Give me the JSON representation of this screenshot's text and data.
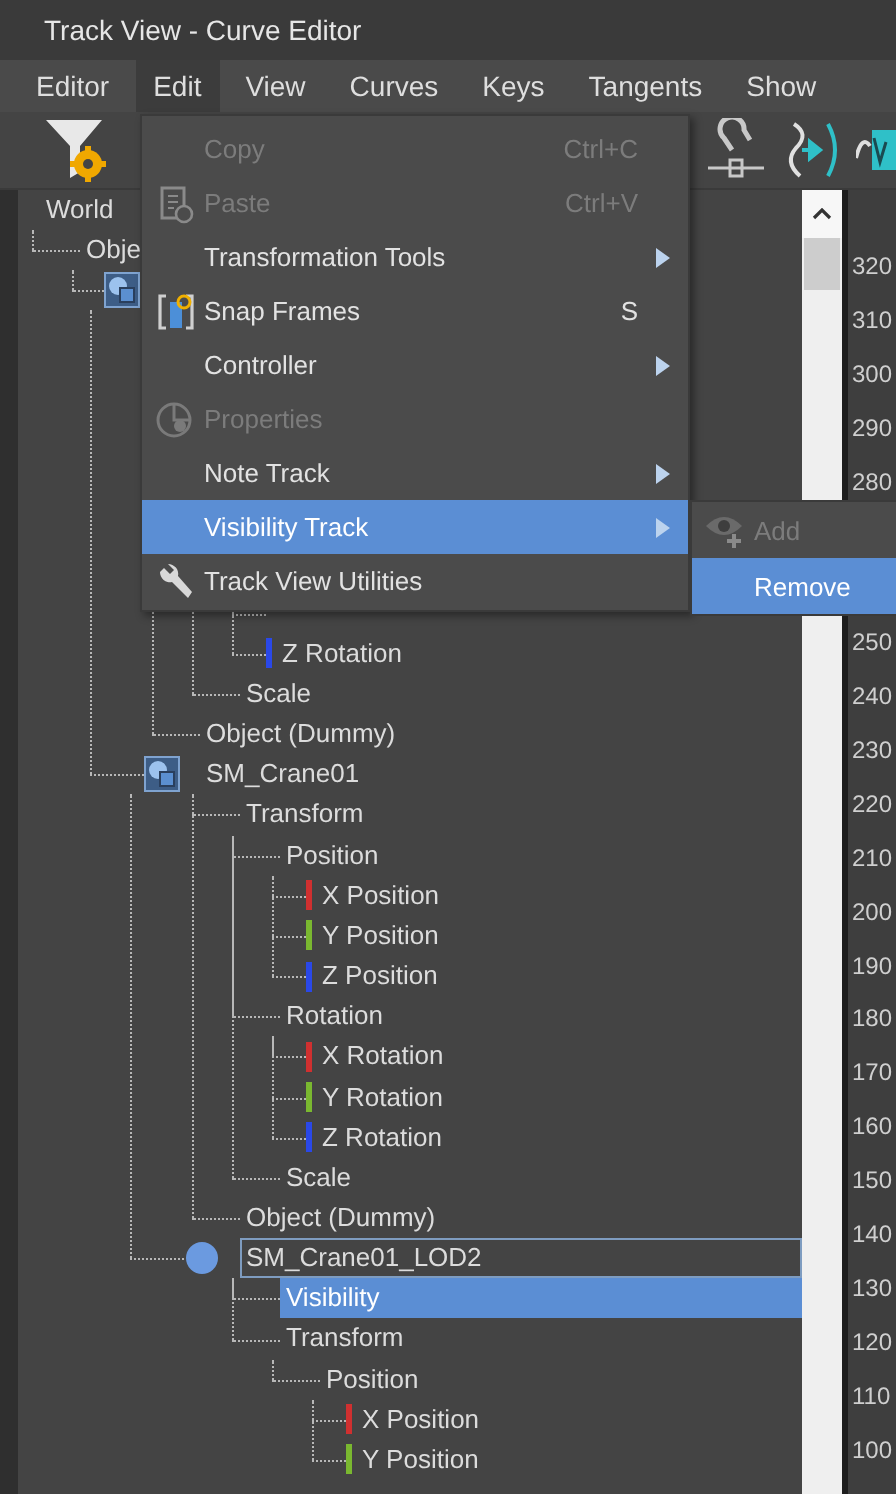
{
  "window": {
    "title": "Track View - Curve Editor"
  },
  "menubar": [
    {
      "label": "Editor",
      "selected": false
    },
    {
      "label": "Edit",
      "selected": true
    },
    {
      "label": "View",
      "selected": false
    },
    {
      "label": "Curves",
      "selected": false
    },
    {
      "label": "Keys",
      "selected": false
    },
    {
      "label": "Tangents",
      "selected": false
    },
    {
      "label": "Show",
      "selected": false
    }
  ],
  "tree": [
    {
      "label": "World",
      "selected": false,
      "focused": false,
      "children": [
        {
          "label": "Obje",
          "selected": false,
          "focused": false,
          "children": [
            {
              "kind": "box",
              "children": [
                {
                  "kind": "track",
                  "children": [
                    {
                      "kind": "track",
                      "children": [
                        {
                          "kind": "axis"
                        },
                        {
                          "kind": "axis"
                        },
                        {
                          "kind": "axis"
                        }
                      ]
                    },
                    {
                      "kind": "track",
                      "children": [
                        {
                          "kind": "axis"
                        },
                        {
                          "kind": "axis"
                        },
                        {
                          "label": "Z Rotation",
                          "kind": "axis",
                          "color": "#2a48e8",
                          "selected": false,
                          "focused": false
                        }
                      ]
                    },
                    {
                      "label": "Scale",
                      "kind": "track",
                      "selected": false,
                      "focused": false
                    }
                  ]
                },
                {
                  "label": "Object (Dummy)",
                  "kind": "track",
                  "selected": false,
                  "focused": false
                },
                {
                  "label": "SM_Crane01",
                  "kind": "box",
                  "selected": false,
                  "focused": false,
                  "children": [
                    {
                      "label": "Transform",
                      "kind": "track",
                      "selected": false,
                      "focused": false,
                      "children": [
                        {
                          "label": "Position",
                          "kind": "track",
                          "selected": false,
                          "focused": false,
                          "children": [
                            {
                              "label": "X Position",
                              "kind": "axis",
                              "color": "#d03030",
                              "selected": false,
                              "focused": false
                            },
                            {
                              "label": "Y Position",
                              "kind": "axis",
                              "color": "#7ab830",
                              "selected": false,
                              "focused": false
                            },
                            {
                              "label": "Z Position",
                              "kind": "axis",
                              "color": "#2a48e8",
                              "selected": false,
                              "focused": false
                            }
                          ]
                        },
                        {
                          "label": "Rotation",
                          "kind": "track",
                          "selected": false,
                          "focused": false,
                          "children": [
                            {
                              "label": "X Rotation",
                              "kind": "axis",
                              "color": "#d03030",
                              "selected": false,
                              "focused": false
                            },
                            {
                              "label": "Y Rotation",
                              "kind": "axis",
                              "color": "#7ab830",
                              "selected": false,
                              "focused": false
                            },
                            {
                              "label": "Z Rotation",
                              "kind": "axis",
                              "color": "#2a48e8",
                              "selected": false,
                              "focused": false
                            }
                          ]
                        },
                        {
                          "label": "Scale",
                          "kind": "track",
                          "selected": false,
                          "focused": false
                        }
                      ]
                    },
                    {
                      "label": "Object (Dummy)",
                      "kind": "track",
                      "selected": false,
                      "focused": false
                    },
                    {
                      "label": "SM_Crane01_LOD2",
                      "kind": "dot",
                      "selected": false,
                      "focused": true,
                      "children": [
                        {
                          "label": "Visibility",
                          "kind": "track",
                          "selected": true,
                          "focused": false
                        },
                        {
                          "label": "Transform",
                          "kind": "track",
                          "selected": false,
                          "focused": false,
                          "children": [
                            {
                              "label": "Position",
                              "kind": "track",
                              "selected": false,
                              "focused": false,
                              "children": [
                                {
                                  "label": "X Position",
                                  "kind": "axis",
                                  "color": "#d03030",
                                  "selected": false,
                                  "focused": false
                                },
                                {
                                  "label": "Y Position",
                                  "kind": "axis",
                                  "color": "#7ab830",
                                  "selected": false,
                                  "focused": false
                                }
                              ]
                            }
                          ]
                        }
                      ]
                    }
                  ]
                }
              ]
            }
          ]
        }
      ]
    }
  ],
  "ruler": {
    "upper": [
      "320",
      "310",
      "300",
      "290",
      "280"
    ],
    "lower": [
      "250",
      "240",
      "230",
      "220",
      "210",
      "200",
      "190",
      "180",
      "170",
      "160",
      "150",
      "140",
      "130",
      "120",
      "110",
      "100"
    ]
  },
  "edit_menu": {
    "items": [
      {
        "label": "Copy",
        "shortcut": "Ctrl+C",
        "disabled": true,
        "submenu": false,
        "selected": false
      },
      {
        "label": "Paste",
        "shortcut": "Ctrl+V",
        "disabled": true,
        "submenu": false,
        "selected": false
      },
      {
        "label": "Transformation Tools",
        "disabled": false,
        "submenu": true,
        "selected": false
      },
      {
        "label": "Snap Frames",
        "shortcut": "S",
        "disabled": false,
        "submenu": false,
        "selected": false
      },
      {
        "label": "Controller",
        "disabled": false,
        "submenu": true,
        "selected": false
      },
      {
        "label": "Properties",
        "disabled": true,
        "submenu": false,
        "selected": false
      },
      {
        "label": "Note Track",
        "disabled": false,
        "submenu": true,
        "selected": false
      },
      {
        "label": "Visibility Track",
        "disabled": false,
        "submenu": true,
        "selected": true
      },
      {
        "label": "Track View Utilities",
        "disabled": false,
        "submenu": false,
        "selected": false
      }
    ]
  },
  "submenu": {
    "items": [
      {
        "label": "Add",
        "disabled": true,
        "selected": false
      },
      {
        "label": "Remove",
        "disabled": false,
        "selected": true
      }
    ]
  }
}
